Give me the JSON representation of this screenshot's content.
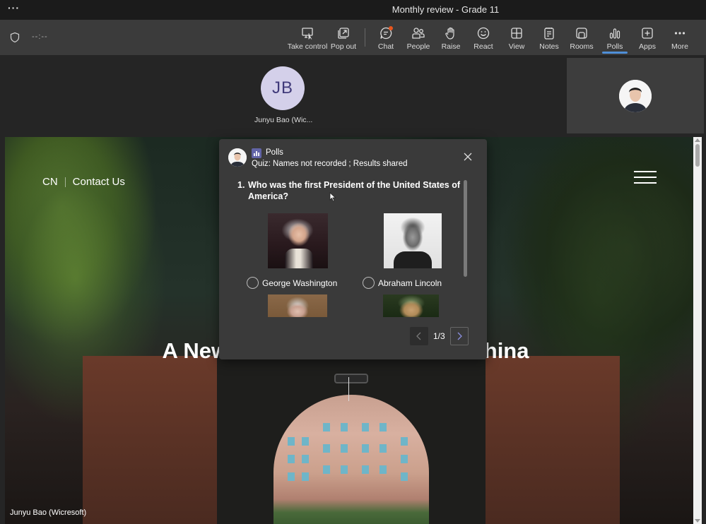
{
  "window": {
    "title": "Monthly review - Grade 11",
    "menu_icon": "more-dots-icon"
  },
  "toolbar": {
    "timer": "--:--",
    "security_icon": "shield-icon",
    "buttons": [
      {
        "id": "take-control",
        "label": "Take control",
        "icon": "take-control-icon"
      },
      {
        "id": "pop-out",
        "label": "Pop out",
        "icon": "pop-out-icon"
      },
      {
        "id": "chat",
        "label": "Chat",
        "icon": "chat-icon",
        "notification": true
      },
      {
        "id": "people",
        "label": "People",
        "icon": "people-icon"
      },
      {
        "id": "raise",
        "label": "Raise",
        "icon": "raise-hand-icon"
      },
      {
        "id": "react",
        "label": "React",
        "icon": "smile-icon"
      },
      {
        "id": "view",
        "label": "View",
        "icon": "grid-view-icon"
      },
      {
        "id": "notes",
        "label": "Notes",
        "icon": "notes-icon"
      },
      {
        "id": "rooms",
        "label": "Rooms",
        "icon": "rooms-icon"
      },
      {
        "id": "polls",
        "label": "Polls",
        "icon": "polls-icon",
        "active": true
      },
      {
        "id": "apps",
        "label": "Apps",
        "icon": "apps-plus-icon"
      },
      {
        "id": "more",
        "label": "More",
        "icon": "more-dots-icon"
      }
    ],
    "accent_color": "#4f8fd8",
    "notification_color": "#e8561e"
  },
  "participants": {
    "main": {
      "initials": "JB",
      "name": "Junyu Bao (Wic..."
    },
    "self_tile": {
      "type": "photo"
    }
  },
  "shared_screen": {
    "nav": {
      "lang": "CN",
      "contact": "Contact Us"
    },
    "hero_title": "A New Model of Education in China",
    "presenter_caption": "Junyu Bao (Wicresoft)"
  },
  "poll": {
    "app_name": "Polls",
    "subtitle": "Quiz: Names not recorded ; Results shared",
    "question_number": "1.",
    "question": "Who was the first President of the United States of America?",
    "options": [
      {
        "label": "George Washington",
        "selected": false
      },
      {
        "label": "Abraham Lincoln",
        "selected": false
      }
    ],
    "pager": {
      "current": 1,
      "total": 3,
      "text": "1/3"
    },
    "brand_color": "#6264a7"
  }
}
